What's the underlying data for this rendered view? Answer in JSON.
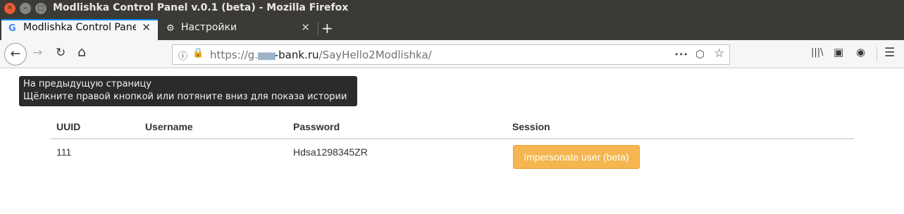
{
  "window": {
    "title": "Modlishka Control Panel v.0.1 (beta) - Mozilla Firefox",
    "controls": {
      "close": "✕",
      "minimize": "–",
      "maximize": "□"
    }
  },
  "tabs": [
    {
      "favicon": "G",
      "label": "Modlishka Control Pane",
      "close": "✕",
      "active": true
    },
    {
      "favicon": "⚙",
      "label": "Настройки",
      "close": "✕",
      "active": false
    }
  ],
  "new_tab": "+",
  "nav": {
    "back": "←",
    "forward": "→",
    "reload": "↻",
    "home": "⌂",
    "info": "ⓘ",
    "lock": "🔒",
    "url_scheme": "https://g.",
    "url_masked": "████",
    "url_host": "-bank.ru",
    "url_path": "/SayHello2Modlishka/",
    "page_actions": "•••",
    "pocket": "⬡",
    "bookmark": "☆",
    "library": "|||\\",
    "sidebar": "▣",
    "account": "◉",
    "menu": "☰"
  },
  "tooltip": {
    "line1": "На предыдущую страницу",
    "line2": "Щёлкните правой кнопкой или потяните вниз для показа истории"
  },
  "table": {
    "headers": [
      "UUID",
      "Username",
      "Password",
      "Session"
    ],
    "rows": [
      {
        "uuid": "111",
        "username": "",
        "password": "Hdsa1298345ZR",
        "session_button": "Impersonate user (beta)"
      }
    ]
  },
  "colors": {
    "accent": "#0a84ff",
    "button": "#f5b54f",
    "lock": "#12bc00"
  }
}
